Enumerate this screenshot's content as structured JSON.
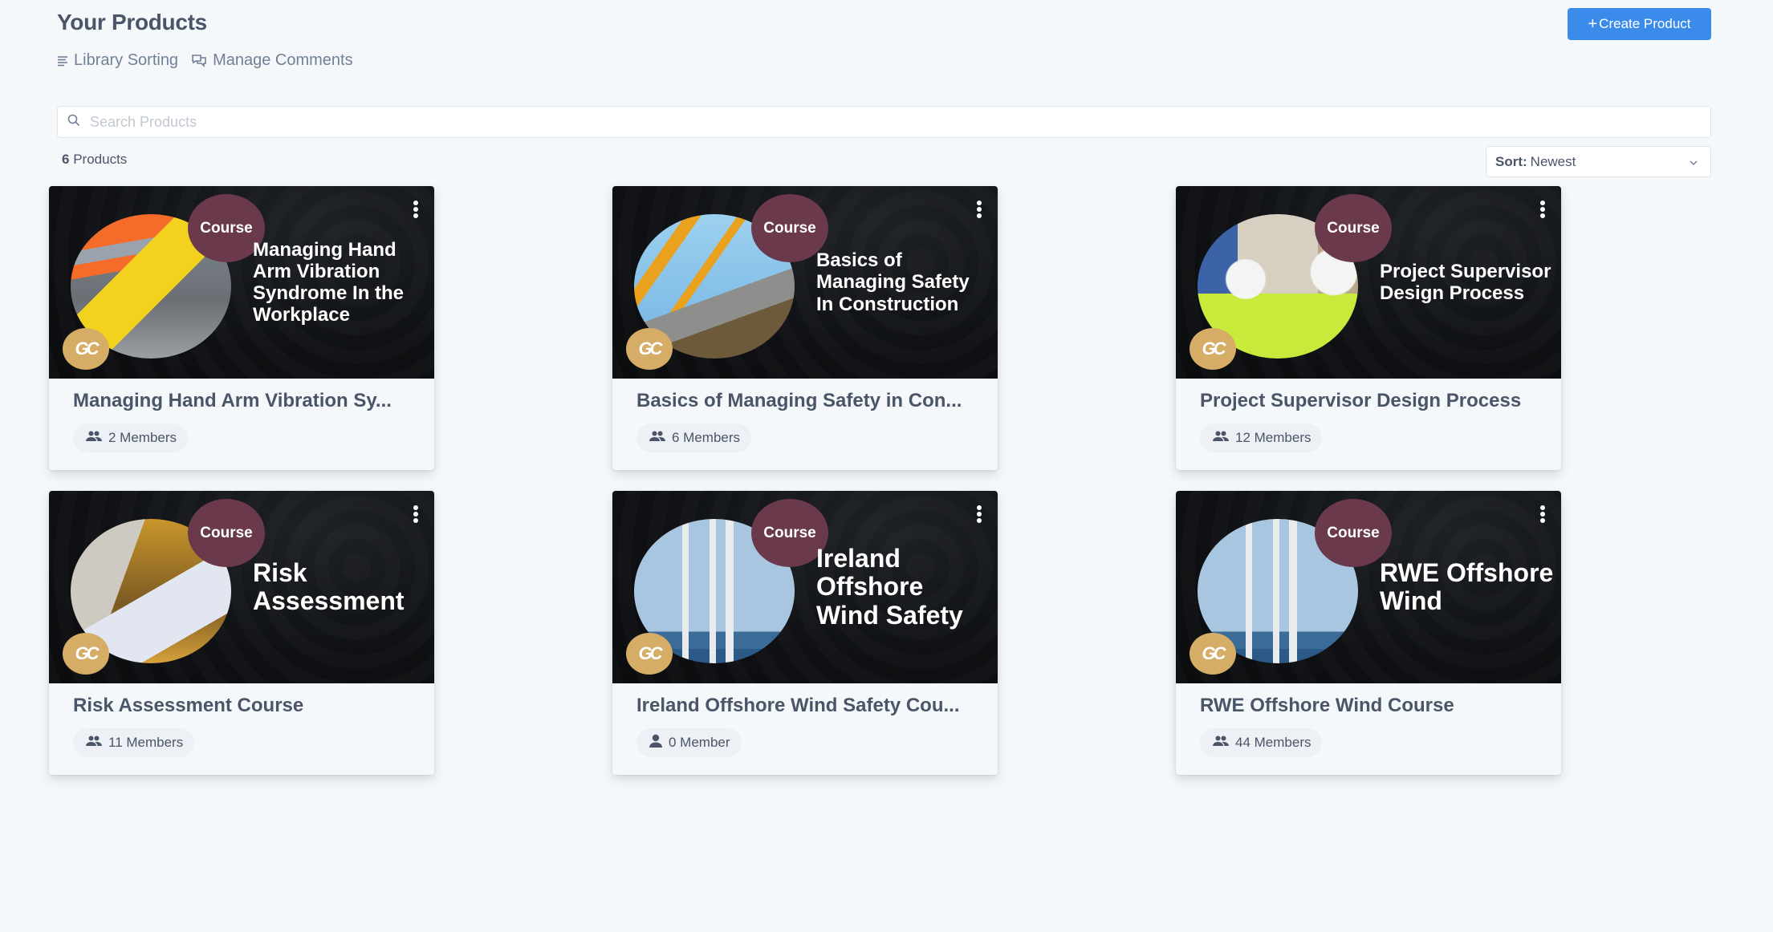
{
  "header": {
    "title": "Your Products",
    "create_button": {
      "icon": "plus-icon",
      "label": "Create Product",
      "color": "#3b8beb"
    }
  },
  "links": [
    {
      "icon": "list-icon",
      "label": "Library Sorting"
    },
    {
      "icon": "comments-icon",
      "label": "Manage Comments"
    }
  ],
  "search": {
    "placeholder": "Search Products",
    "value": "",
    "icon": "search-icon"
  },
  "summary": {
    "count": "6",
    "label": "Products"
  },
  "sort": {
    "label": "Sort:",
    "value": "Newest",
    "icon": "chevron-down-icon"
  },
  "products": [
    {
      "badge": "Course",
      "thumb_text": "Managing Hand Arm Vibration Syndrome In the Workplace",
      "title": "Managing Hand Arm Vibration Sy...",
      "members": "2 Members",
      "member_icon": "users-icon"
    },
    {
      "badge": "Course",
      "thumb_text": "Basics of Managing Safety In Construction",
      "title": "Basics of Managing Safety in Con...",
      "members": "6 Members",
      "member_icon": "users-icon"
    },
    {
      "badge": "Course",
      "thumb_text": "Project Supervisor Design Process",
      "title": "Project Supervisor Design Process",
      "members": "12 Members",
      "member_icon": "users-icon"
    },
    {
      "badge": "Course",
      "thumb_text": "Risk Assessment",
      "title": "Risk Assessment Course",
      "members": "11 Members",
      "member_icon": "users-icon"
    },
    {
      "badge": "Course",
      "thumb_text": "Ireland Offshore Wind Safety",
      "title": "Ireland Offshore Wind Safety Cou...",
      "members": "0 Member",
      "member_icon": "user-icon"
    },
    {
      "badge": "Course",
      "thumb_text": "RWE Offshore Wind",
      "title": "RWE Offshore Wind Course",
      "members": "44 Members",
      "member_icon": "users-icon"
    }
  ],
  "logo_text": "GC",
  "colors": {
    "accent": "#3b8beb",
    "course_badge": "#6a3a4c",
    "logo": "#d6ad66",
    "background": "#f5f8fb"
  }
}
